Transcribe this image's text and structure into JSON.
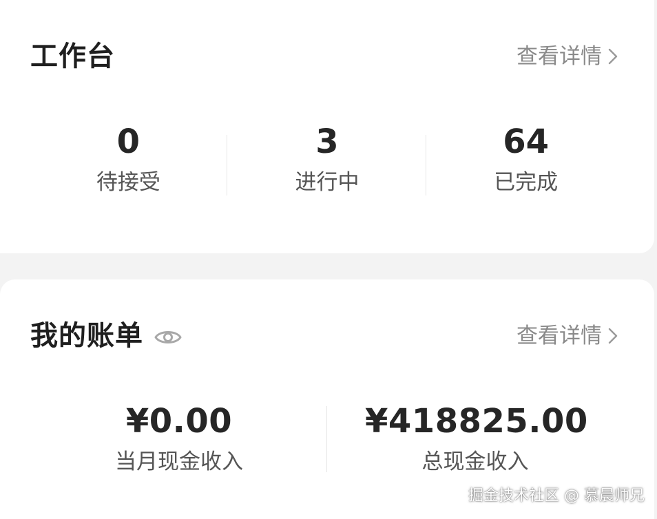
{
  "workbench": {
    "title": "工作台",
    "detail_link": "查看详情",
    "stats": [
      {
        "value": "0",
        "label": "待接受"
      },
      {
        "value": "3",
        "label": "进行中"
      },
      {
        "value": "64",
        "label": "已完成"
      }
    ]
  },
  "bill": {
    "title": "我的账单",
    "detail_link": "查看详情",
    "monthly": {
      "value": "¥0.00",
      "label": "当月现金收入"
    },
    "total": {
      "value": "¥418825.00",
      "label": "总现金收入"
    }
  },
  "watermark": "掘金技术社区 @ 慕晨师兄",
  "icons": {
    "eye": "eye-icon",
    "chevron": "chevron-right-icon"
  },
  "colors": {
    "background": "#f3f3f3",
    "card": "#ffffff",
    "title": "#1f1f1f",
    "muted": "#8a8a8a",
    "label": "#555555"
  }
}
